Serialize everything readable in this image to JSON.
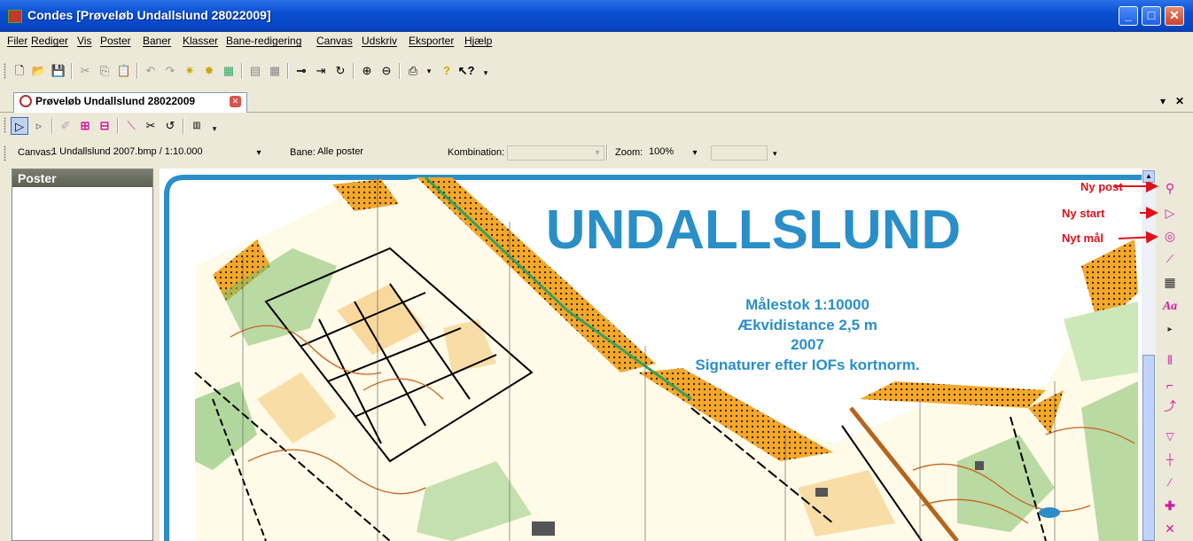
{
  "window": {
    "title": "Condes [Prøveløb Undallslund 28022009]",
    "min_label": "_",
    "max_label": "□",
    "close_label": "✕"
  },
  "menu": [
    "Filer",
    "Rediger",
    "Vis",
    "Poster",
    "Baner",
    "Klasser",
    "Bane-redigering",
    "Canvas",
    "Udskriv",
    "Eksporter",
    "Hjælp"
  ],
  "document_tab": {
    "label": "Prøveløb Undallslund 28022009",
    "pin_label": "▾",
    "close_label": "✕"
  },
  "canvas_bar": {
    "canvas_label": "Canvas:",
    "canvas_value": "1 Undallslund 2007.bmp  / 1:10.000",
    "bane_label": "Bane:",
    "bane_value": "Alle poster",
    "kombination_label": "Kombination:",
    "kombination_value": "",
    "zoom_label": "Zoom:",
    "zoom_value": "100%"
  },
  "panel": {
    "title": "Poster"
  },
  "map": {
    "title": "UNDALLSLUND",
    "legend_lines": [
      "Målestok 1:10000",
      "Ækvidistance 2,5 m",
      "2007",
      "Signaturer efter IOFs kortnorm."
    ]
  },
  "annotations": {
    "ny_post": "Ny post",
    "ny_start": "Ny start",
    "nyt_maal": "Nyt mål"
  },
  "colors": {
    "title_bar": "#0a4fd1",
    "map_blue": "#2a8fc8",
    "forest_green": "#7fbf6a",
    "orange_yellow": "#f4a72a",
    "annotation_red": "#e0101a",
    "tool_magenta": "#d21aa8"
  }
}
